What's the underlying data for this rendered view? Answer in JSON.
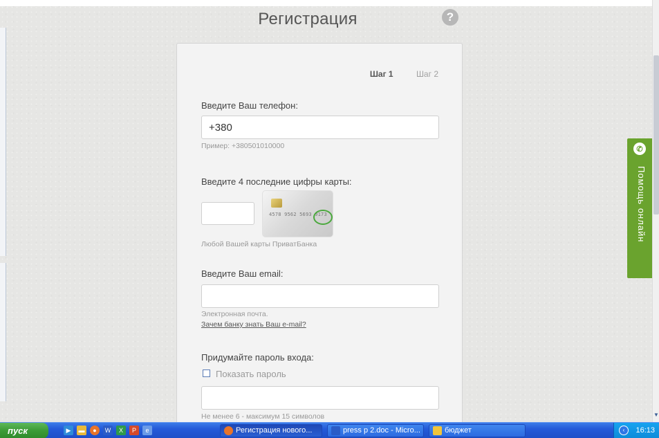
{
  "page": {
    "title": "Регистрация",
    "help_symbol": "?"
  },
  "steps": {
    "step1": "Шаг 1",
    "step2": "Шаг 2"
  },
  "form": {
    "phone": {
      "label": "Введите Ваш телефон:",
      "value": "+380",
      "hint": "Пример: +380501010000"
    },
    "card": {
      "label": "Введите 4 последние цифры карты:",
      "hint": "Любой Вашей карты ПриватБанка",
      "image_digits": "4578 9562 5693 9173"
    },
    "email": {
      "label": "Введите Ваш email:",
      "value": "",
      "hint": "Электронная почта.",
      "link": "Зачем банку знать Ваш e-mail?"
    },
    "password": {
      "label": "Придумайте пароль входа:",
      "show_label": "Показать пароль",
      "value": "",
      "hint": "Не менее 6 - максимум 15 символов"
    }
  },
  "help_widget": {
    "text": "Помощь онлайн"
  },
  "taskbar": {
    "start_label": "пуск",
    "tasks": [
      {
        "label": "Регистрация нового...",
        "icon_color": "#e8742a"
      },
      {
        "label": "press p 2.doc - Micro...",
        "icon_color": "#2b5cc7"
      },
      {
        "label": "бюджет",
        "icon_color": "#f0c43c"
      }
    ],
    "clock": "16:13"
  },
  "colors": {
    "accent_green": "#6aa32e",
    "taskbar_blue": "#245ad9",
    "start_green": "#3b9b36"
  }
}
